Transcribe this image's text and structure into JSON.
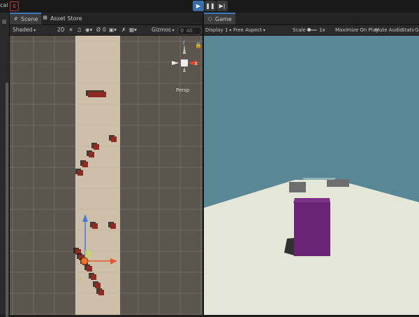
{
  "toolbar": {
    "left_cut_text": "cal",
    "play_icon": "play-icon",
    "pause_icon": "pause-icon",
    "step_icon": "step-icon"
  },
  "scene_panel": {
    "tabs": [
      {
        "label": "Scene",
        "icon": "grid-icon"
      },
      {
        "label": "Asset Store",
        "icon": "store-icon"
      }
    ],
    "toolbar": {
      "shading_mode": "Shaded",
      "mode_2d": "2D",
      "layer_count": "0",
      "gizmos_label": "Gizmos",
      "search_placeholder": "All"
    },
    "gizmo": {
      "y_label": "y",
      "x_label": "x",
      "projection_label": "Persp"
    },
    "colors": {
      "background": "#5c554d",
      "road": "#cdbfa9",
      "grid": "#7a7168",
      "obstacle": "#8e2a22"
    }
  },
  "game_panel": {
    "tab": {
      "label": "Game",
      "icon": "gamepad-icon"
    },
    "toolbar": {
      "display": "Display 1",
      "aspect": "Free Aspect",
      "scale_label": "Scale",
      "scale_value": "1x",
      "maximize": "Maximize On Play",
      "mute": "Mute Audio",
      "stats": "Stats",
      "gizmos_cut": "G"
    },
    "colors": {
      "sky": "#5a8795",
      "ground": "#e4e6d8",
      "player_cube": "#6a2475",
      "obstacle": "#6e6e6e"
    }
  }
}
